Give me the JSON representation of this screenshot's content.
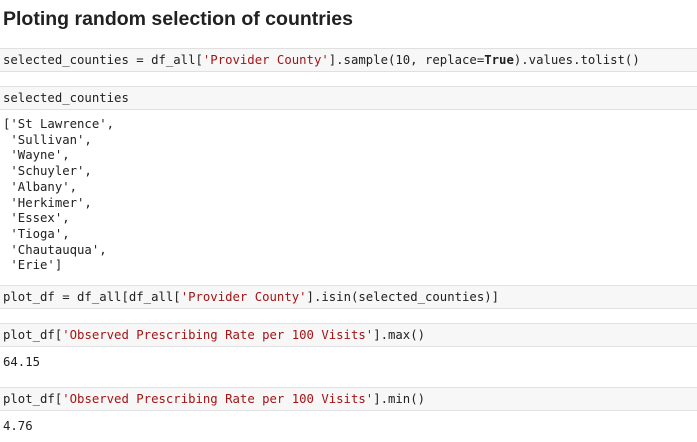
{
  "notebook": {
    "heading": "Ploting random selection of countries",
    "cells": [
      {
        "input": {
          "t1": "selected_counties = df_all[",
          "s1": "'Provider County'",
          "t2": "].sample(10, replace=",
          "kw": "True",
          "t3": ").values.tolist()"
        }
      },
      {
        "input": {
          "t1": "selected_counties"
        },
        "output_lines": [
          "['St Lawrence',",
          " 'Sullivan',",
          " 'Wayne',",
          " 'Schuyler',",
          " 'Albany',",
          " 'Herkimer',",
          " 'Essex',",
          " 'Tioga',",
          " 'Chautauqua',",
          " 'Erie']"
        ]
      },
      {
        "input": {
          "t1": "plot_df = df_all[df_all[",
          "s1": "'Provider County'",
          "t2": "].isin(selected_counties)]"
        }
      },
      {
        "input": {
          "t1": "plot_df[",
          "s1": "'Observed Prescribing Rate per 100 Visits'",
          "t2": "].max()"
        },
        "output": "64.15"
      },
      {
        "input": {
          "t1": "plot_df[",
          "s1": "'Observed Prescribing Rate per 100 Visits'",
          "t2": "].min()"
        },
        "output": "4.76"
      }
    ],
    "colors": {
      "cell_background": "#f7f7f7",
      "cell_border": "#e0e0e0",
      "string_literal": "#a31515",
      "text": "#212121"
    }
  }
}
